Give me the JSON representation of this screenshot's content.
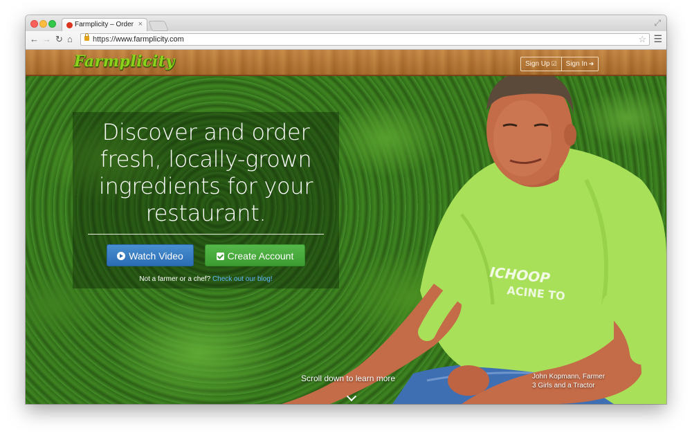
{
  "browser": {
    "tab_title": "Farmplicity – Order Fresh...",
    "tab_close": "×",
    "url_scheme": "https://",
    "url_host": "www.farmplicity.com"
  },
  "site": {
    "logo_text": "Farmplicity",
    "sign_up_label": "Sign Up",
    "sign_in_label": "Sign In"
  },
  "hero": {
    "headline": "Discover and order fresh, locally-grown ingredients for your restaurant.",
    "watch_video_label": "Watch Video",
    "create_account_label": "Create Account",
    "subline_text": "Not a farmer or a chef?",
    "blog_link_text": "Check out our blog!",
    "scroll_text": "Scroll down to learn more",
    "caption_name": "John Kopmann, Farmer",
    "caption_farm": "3 Girls and a Tractor",
    "shirt_text_line1": "ICHOOP",
    "shirt_text_line2": "ACINE TO"
  },
  "colors": {
    "logo_green": "#8ed11c",
    "header_wood": "#b8742f",
    "watch_video_blue": "#2b6db4",
    "create_account_green": "#3c9c31",
    "blog_link_blue": "#5fb7ff",
    "shirt_green": "#a9e05a"
  },
  "icons": {
    "tab_close": "close-icon",
    "nav_back": "back-arrow-icon",
    "nav_forward": "forward-arrow-icon",
    "reload": "reload-icon",
    "home": "home-icon",
    "lock": "lock-icon",
    "bookmark": "star-icon",
    "menu": "hamburger-menu-icon",
    "sign_up": "check-square-icon",
    "sign_in": "sign-in-icon",
    "watch_video": "play-circle-icon",
    "create_account": "check-square-icon",
    "scroll": "chevron-down-icon"
  }
}
